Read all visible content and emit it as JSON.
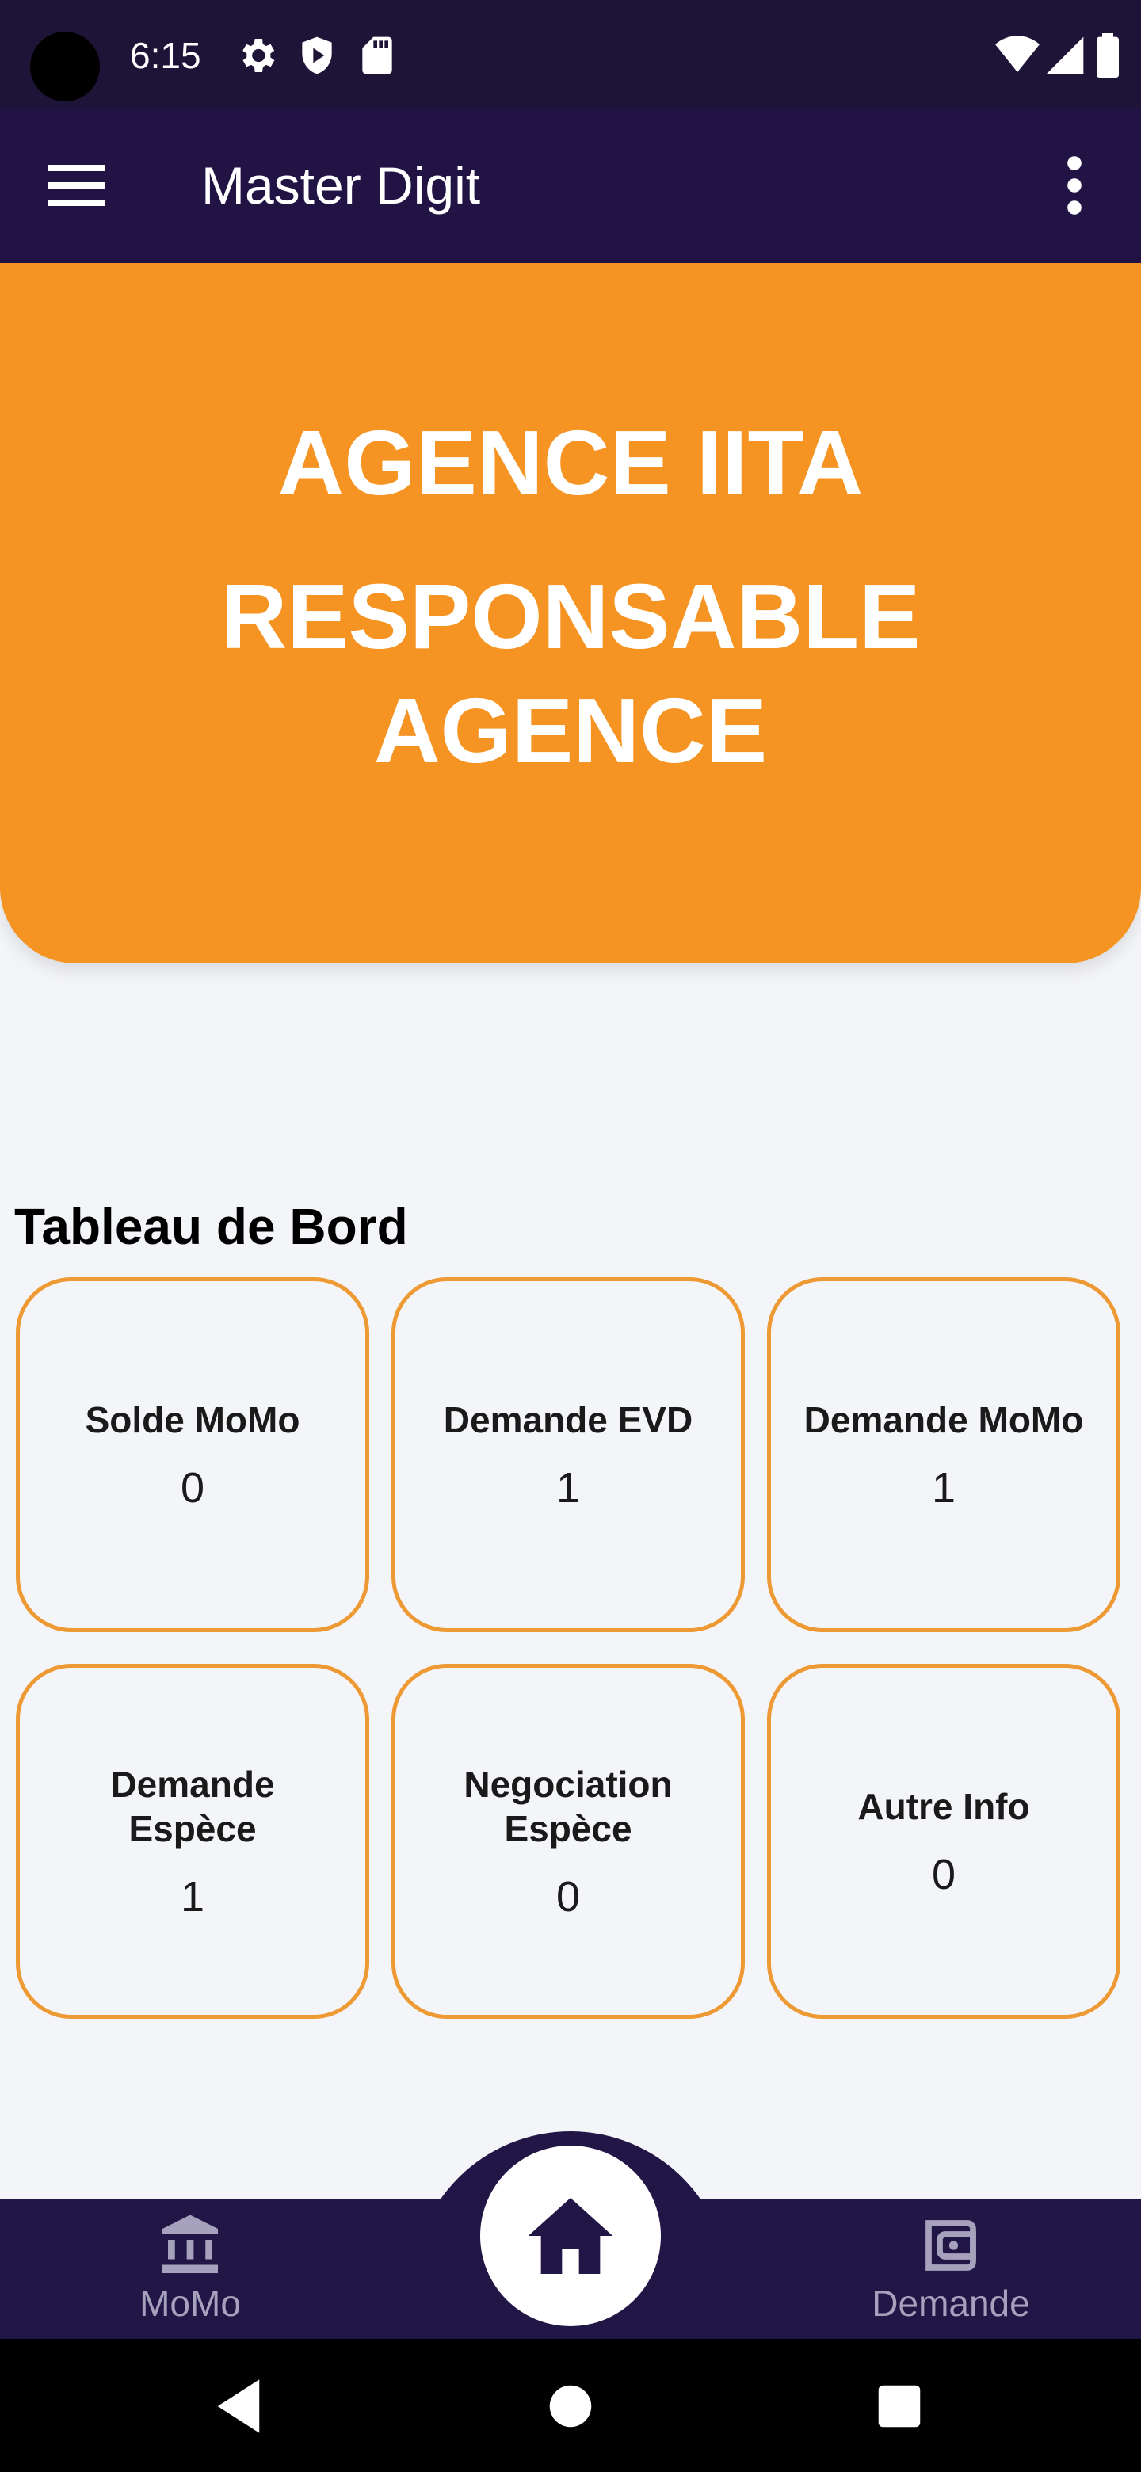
{
  "status_bar": {
    "time": "6:15",
    "icons_left": [
      "settings-icon",
      "shield-play-icon",
      "sd-card-icon"
    ],
    "icons_right": [
      "wifi-icon",
      "cell-signal-icon",
      "battery-icon"
    ]
  },
  "app_bar": {
    "title": "Master Digit",
    "menu_icon": "hamburger-menu-icon",
    "more_icon": "more-vertical-icon"
  },
  "banner": {
    "line1": "AGENCE IITA",
    "line2": "RESPONSABLE AGENCE",
    "color": "#F59423"
  },
  "dashboard": {
    "title": "Tableau de Bord",
    "cards": [
      {
        "label": "Solde MoMo",
        "value": "0"
      },
      {
        "label": "Demande EVD",
        "value": "1"
      },
      {
        "label": "Demande MoMo",
        "value": "1"
      },
      {
        "label": "Demande Espèce",
        "value": "1"
      },
      {
        "label": "Negociation Espèce",
        "value": "0"
      },
      {
        "label": "Autre Info",
        "value": "0"
      }
    ],
    "card_border_color": "#EE9A34"
  },
  "bottom_nav": {
    "items": [
      {
        "label": "MoMo",
        "icon": "bank-icon"
      },
      {
        "label": "Demande",
        "icon": "wallet-icon"
      }
    ],
    "home_icon": "home-icon",
    "background": "#221647"
  },
  "system_nav": {
    "back_icon": "back-triangle-icon",
    "home_icon": "home-circle-icon",
    "recents_icon": "recents-square-icon"
  }
}
